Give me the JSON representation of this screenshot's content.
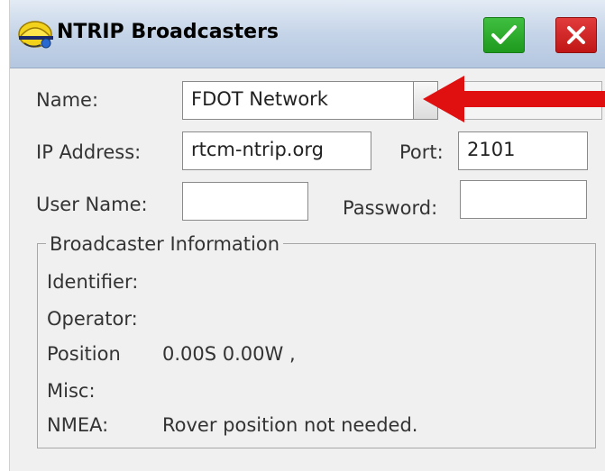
{
  "window": {
    "title": "NTRIP Broadcasters"
  },
  "icons": {
    "app": "yellow-helmet-icon",
    "ok": "checkmark-icon",
    "close": "close-x-icon",
    "annotation": "red-arrow-icon"
  },
  "colors": {
    "ok": "#22a822",
    "close": "#d42020",
    "arrow": "#e01010"
  },
  "form": {
    "name_label": "Name:",
    "name_value": "FDOT Network",
    "ip_label": "IP Address:",
    "ip_value": "rtcm-ntrip.org",
    "port_label": "Port:",
    "port_value": "2101",
    "user_label": "User Name:",
    "user_value": "",
    "password_label": "Password:",
    "password_value": ""
  },
  "info": {
    "title": "Broadcaster Information",
    "identifier_label": "Identifier:",
    "operator_label": "Operator:",
    "position_label": "Position",
    "position_value": "0.00S 0.00W ,",
    "misc_label": "Misc:",
    "nmea_label": "NMEA:",
    "nmea_value": "Rover position not needed."
  }
}
